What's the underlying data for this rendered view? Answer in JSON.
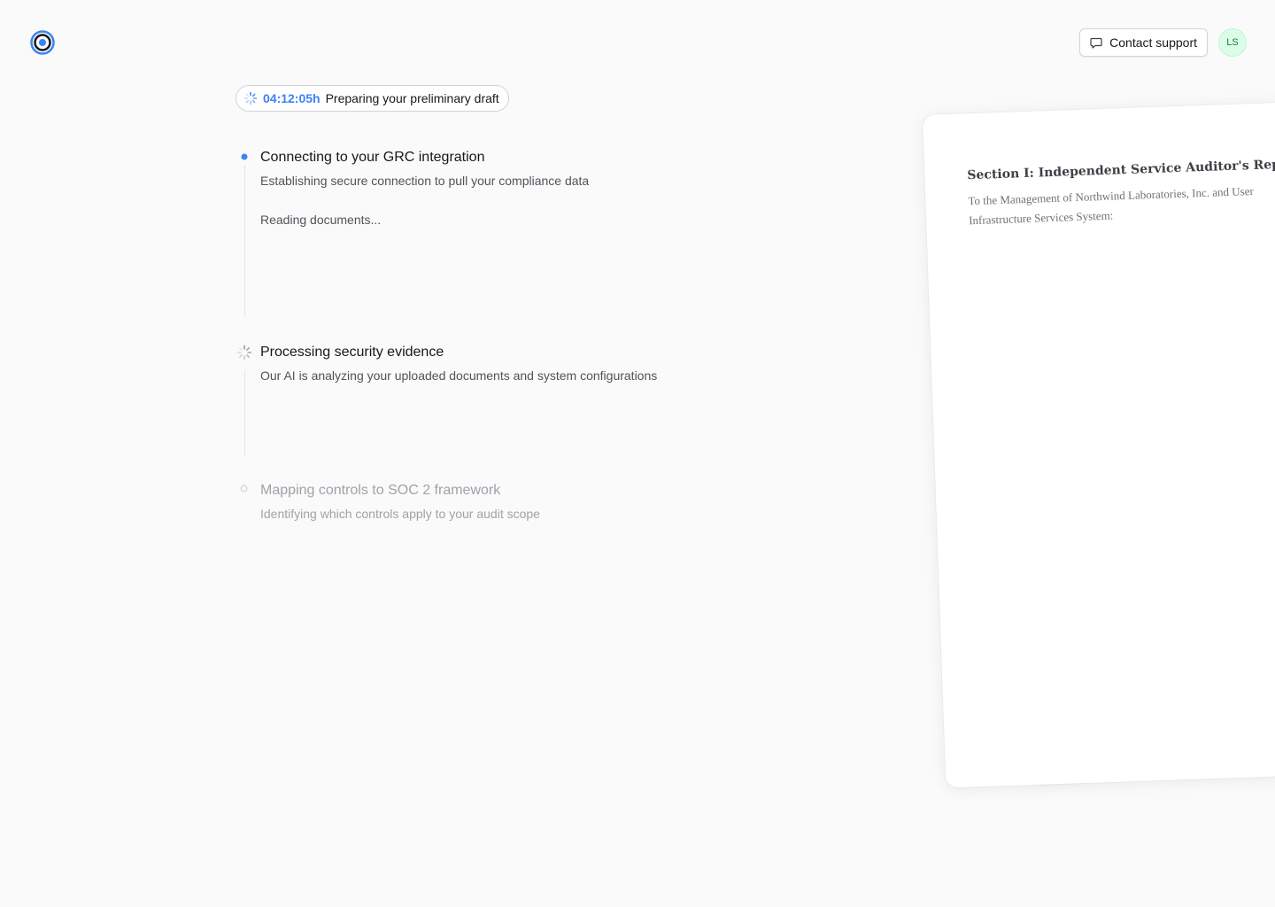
{
  "header": {
    "logo_icon": "target-icon",
    "support_button": {
      "label": "Contact support",
      "icon": "message-square-icon"
    },
    "avatar": {
      "initials": "LS",
      "bg": "#dcfce7",
      "fg": "#15803d"
    }
  },
  "status": {
    "icon": "loader-icon",
    "timer": "04:12:05h",
    "message": "Preparing your preliminary draft",
    "accent": "#3b82f6"
  },
  "steps": [
    {
      "title": "Connecting to your GRC integration",
      "description": "Establishing secure connection to pull your compliance data",
      "detail": "Reading documents...",
      "state": "active",
      "marker_icon": "dot-icon"
    },
    {
      "title": "Processing security evidence",
      "description": "Our AI is analyzing your uploaded documents and system configurations",
      "state": "loading",
      "marker_icon": "loader-icon"
    },
    {
      "title": "Mapping controls to SOC 2 framework",
      "description": "Identifying which controls apply to your audit scope",
      "state": "pending",
      "marker_icon": "circle-icon"
    }
  ],
  "preview": {
    "title": "Section I: Independent Service Auditor's Report",
    "line1": "To the Management of Northwind Laboratories, Inc. and User",
    "line2": "Infrastructure Services System:"
  }
}
